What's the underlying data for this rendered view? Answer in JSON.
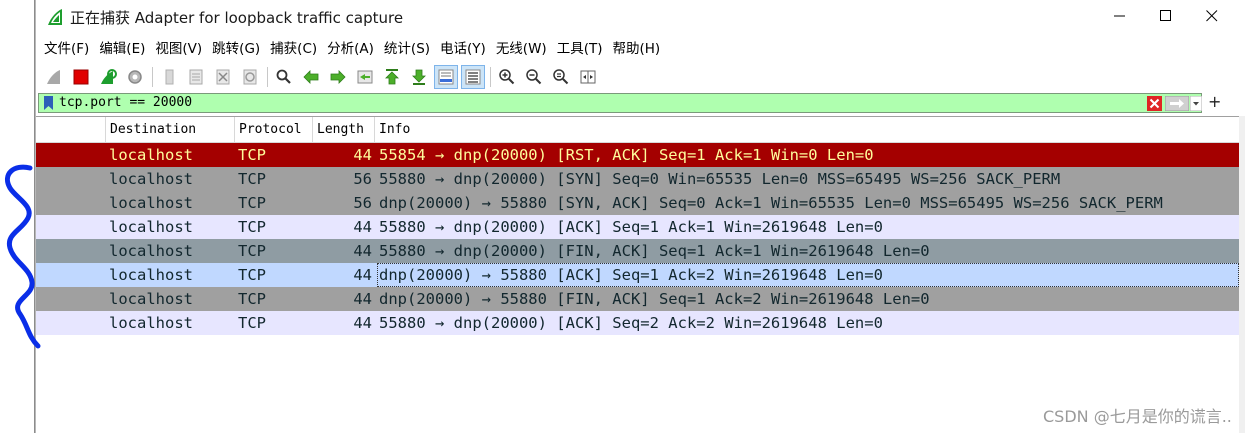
{
  "window": {
    "title": "正在捕获 Adapter for loopback traffic capture",
    "icon": "wireshark-shark-fin-icon"
  },
  "menu": [
    "文件(F)",
    "编辑(E)",
    "视图(V)",
    "跳转(G)",
    "捕获(C)",
    "分析(A)",
    "统计(S)",
    "电话(Y)",
    "无线(W)",
    "工具(T)",
    "帮助(H)"
  ],
  "filter": {
    "value": "tcp.port == 20000",
    "bg_color": "#afffaf"
  },
  "columns": {
    "destination": "Destination",
    "protocol": "Protocol",
    "length": "Length",
    "info": "Info"
  },
  "rows": [
    {
      "destination": "localhost",
      "protocol": "TCP",
      "length": "44",
      "info": "55854 → dnp(20000) [RST, ACK] Seq=1 Ack=1 Win=0 Len=0",
      "bg": "#a40000",
      "fg": "#fffc9c"
    },
    {
      "destination": "localhost",
      "protocol": "TCP",
      "length": "56",
      "info": "55880 → dnp(20000) [SYN] Seq=0 Win=65535 Len=0 MSS=65495 WS=256 SACK_PERM",
      "bg": "#a0a0a0",
      "fg": "#12272e"
    },
    {
      "destination": "localhost",
      "protocol": "TCP",
      "length": "56",
      "info": "dnp(20000) → 55880 [SYN, ACK] Seq=0 Ack=1 Win=65535 Len=0 MSS=65495 WS=256 SACK_PERM",
      "bg": "#a0a0a0",
      "fg": "#12272e"
    },
    {
      "destination": "localhost",
      "protocol": "TCP",
      "length": "44",
      "info": "55880 → dnp(20000) [ACK] Seq=1 Ack=1 Win=2619648 Len=0",
      "bg": "#e7e6ff",
      "fg": "#12272e"
    },
    {
      "destination": "localhost",
      "protocol": "TCP",
      "length": "44",
      "info": "55880 → dnp(20000) [FIN, ACK] Seq=1 Ack=1 Win=2619648 Len=0",
      "bg": "#8f9ca3",
      "fg": "#12272e"
    },
    {
      "destination": "localhost",
      "protocol": "TCP",
      "length": "44",
      "info": "dnp(20000) → 55880 [ACK] Seq=1 Ack=2 Win=2619648 Len=0",
      "bg": "#c0d8ff",
      "fg": "#12272e",
      "selected": true
    },
    {
      "destination": "localhost",
      "protocol": "TCP",
      "length": "44",
      "info": "dnp(20000) → 55880 [FIN, ACK] Seq=1 Ack=2 Win=2619648 Len=0",
      "bg": "#a0a0a0",
      "fg": "#12272e"
    },
    {
      "destination": "localhost",
      "protocol": "TCP",
      "length": "44",
      "info": "55880 → dnp(20000) [ACK] Seq=2 Ack=2 Win=2619648 Len=0",
      "bg": "#e7e6ff",
      "fg": "#12272e"
    }
  ],
  "watermark": "CSDN @七月是你的谎言..",
  "colors": {
    "annotation": "#0a2ee8",
    "selection_border": "#7eb4ea"
  }
}
